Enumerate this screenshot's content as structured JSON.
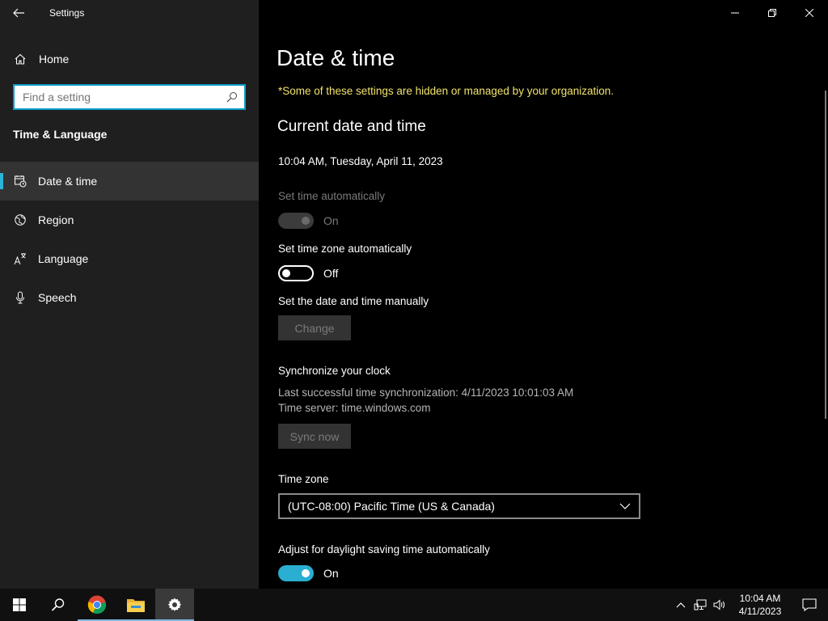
{
  "app": {
    "title": "Settings"
  },
  "sidebar": {
    "home_label": "Home",
    "search_placeholder": "Find a setting",
    "section_title": "Time & Language",
    "items": [
      {
        "label": "Date & time",
        "icon": "date-time-icon",
        "active": true
      },
      {
        "label": "Region",
        "icon": "region-icon",
        "active": false
      },
      {
        "label": "Language",
        "icon": "language-icon",
        "active": false
      },
      {
        "label": "Speech",
        "icon": "microphone-icon",
        "active": false
      }
    ]
  },
  "main": {
    "title": "Date & time",
    "org_note": "*Some of these settings are hidden or managed by your organization.",
    "current_heading": "Current date and time",
    "current_value": "10:04 AM, Tuesday, April 11, 2023",
    "set_time_auto": {
      "label": "Set time automatically",
      "state": "On",
      "enabled": false
    },
    "set_tz_auto": {
      "label": "Set time zone automatically",
      "state": "Off",
      "enabled": true
    },
    "manual": {
      "label": "Set the date and time manually",
      "button": "Change"
    },
    "sync": {
      "heading": "Synchronize your clock",
      "last_sync": "Last successful time synchronization: 4/11/2023 10:01:03 AM",
      "server": "Time server: time.windows.com",
      "button": "Sync now"
    },
    "timezone": {
      "label": "Time zone",
      "value": "(UTC-08:00) Pacific Time (US & Canada)"
    },
    "dst": {
      "label": "Adjust for daylight saving time automatically",
      "state": "On"
    }
  },
  "taskbar": {
    "time": "10:04 AM",
    "date": "4/11/2023"
  },
  "colors": {
    "accent": "#2aaed1",
    "org_note": "#f2e26a",
    "sidebar_bg": "#1f1f1f"
  }
}
